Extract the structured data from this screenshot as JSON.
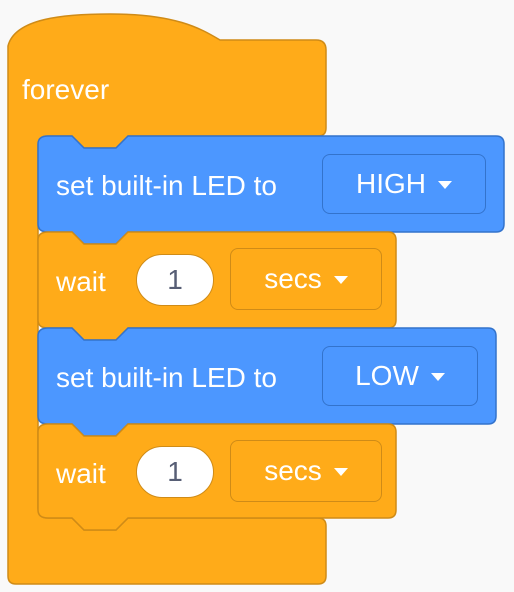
{
  "script": {
    "forever": {
      "label": "forever",
      "color": "#ffab19"
    },
    "blocks": [
      {
        "type": "set-led",
        "label": "set built-in LED to",
        "value": "HIGH",
        "color": "#4c97ff"
      },
      {
        "type": "wait",
        "label": "wait",
        "amount": "1",
        "unit": "secs",
        "color": "#ffab19"
      },
      {
        "type": "set-led",
        "label": "set built-in LED to",
        "value": "LOW",
        "color": "#4c97ff"
      },
      {
        "type": "wait",
        "label": "wait",
        "amount": "1",
        "unit": "secs",
        "color": "#ffab19"
      }
    ]
  },
  "icons": {
    "dropdown": "chevron-down-icon"
  }
}
